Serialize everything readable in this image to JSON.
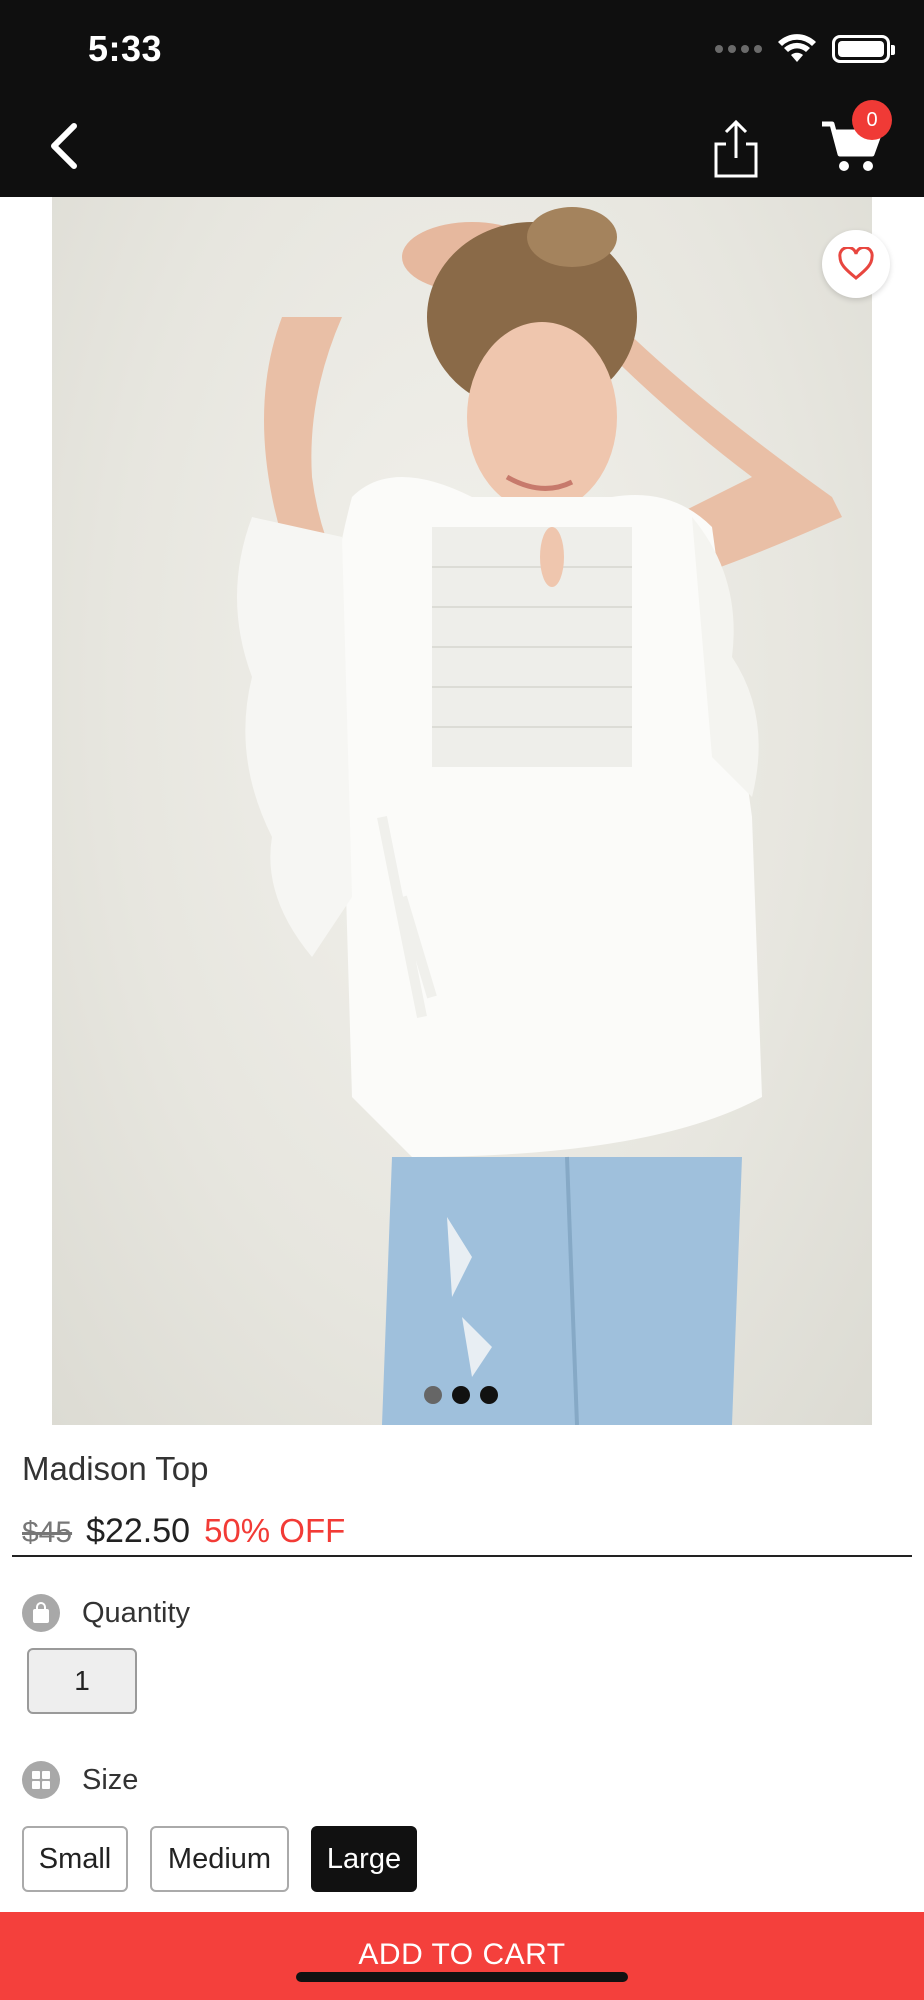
{
  "status_bar": {
    "time": "5:33"
  },
  "nav": {
    "cart_count": "0"
  },
  "gallery": {
    "dots": [
      "inactive",
      "active",
      "active"
    ]
  },
  "product": {
    "name": "Madison Top",
    "old_price": "$45",
    "new_price": "$22.50",
    "discount": "50% OFF"
  },
  "quantity": {
    "label": "Quantity",
    "value": "1"
  },
  "size": {
    "label": "Size",
    "options": [
      "Small",
      "Medium",
      "Large"
    ],
    "selected": "Large"
  },
  "cta": {
    "label": "ADD TO CART"
  },
  "colors": {
    "accent": "#f4403c",
    "dark": "#0f0f0f"
  }
}
